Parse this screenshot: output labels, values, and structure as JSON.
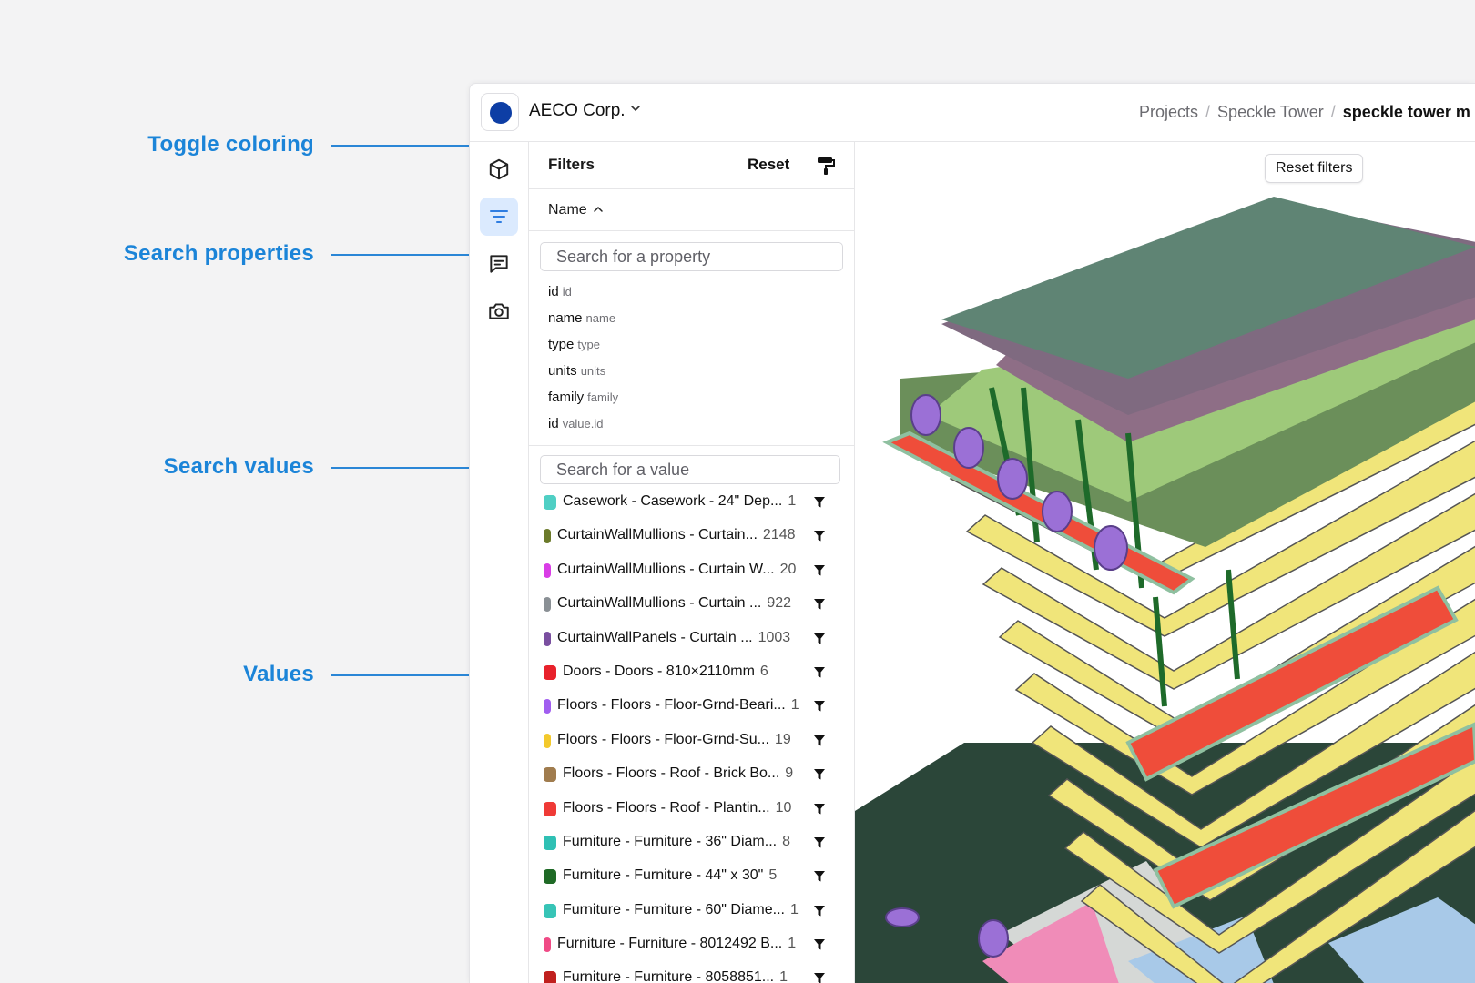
{
  "annotations": [
    {
      "label": "Toggle coloring"
    },
    {
      "label": "Search properties"
    },
    {
      "label": "Search values"
    },
    {
      "label": "Values"
    }
  ],
  "workspace": {
    "name": "AECO Corp.",
    "avatar_color": "#0d3ea5"
  },
  "breadcrumb": {
    "items": [
      "Projects",
      "Speckle Tower"
    ],
    "current": "speckle tower m"
  },
  "sidebar": {
    "icons": [
      "cube-icon",
      "filter-icon",
      "comment-icon",
      "camera-icon"
    ]
  },
  "filters": {
    "title": "Filters",
    "reset_label": "Reset",
    "sort_label": "Name",
    "property_search": {
      "placeholder": "Search for a property"
    },
    "properties": [
      {
        "key": "id",
        "path": "id"
      },
      {
        "key": "name",
        "path": "name"
      },
      {
        "key": "type",
        "path": "type"
      },
      {
        "key": "units",
        "path": "units"
      },
      {
        "key": "family",
        "path": "family"
      },
      {
        "key": "id",
        "path": "value.id"
      }
    ],
    "value_search": {
      "placeholder": "Search for a value"
    },
    "values": [
      {
        "label": "Casework - Casework - 24\" Dep...",
        "count": "1",
        "color": "#4fcfc4"
      },
      {
        "label": "CurtainWallMullions - Curtain...",
        "count": "2148",
        "color": "#6b7a2a"
      },
      {
        "label": "CurtainWallMullions - Curtain W...",
        "count": "20",
        "color": "#d93de6"
      },
      {
        "label": "CurtainWallMullions - Curtain ...",
        "count": "922",
        "color": "#8a9095"
      },
      {
        "label": "CurtainWallPanels - Curtain ...",
        "count": "1003",
        "color": "#7a4fa0"
      },
      {
        "label": "Doors - Doors - 810×2110mm",
        "count": "6",
        "color": "#e8212b"
      },
      {
        "label": "Floors - Floors - Floor-Grnd-Beari...",
        "count": "1",
        "color": "#a15ef0"
      },
      {
        "label": "Floors - Floors - Floor-Grnd-Su...",
        "count": "19",
        "color": "#f3c92c"
      },
      {
        "label": "Floors - Floors - Roof - Brick Bo...",
        "count": "9",
        "color": "#a07c4e"
      },
      {
        "label": "Floors - Floors - Roof - Plantin...",
        "count": "10",
        "color": "#ef3a36"
      },
      {
        "label": "Furniture - Furniture - 36\" Diam...",
        "count": "8",
        "color": "#2fc0b4"
      },
      {
        "label": "Furniture - Furniture - 44\" x 30\"",
        "count": "5",
        "color": "#1f6a26"
      },
      {
        "label": "Furniture - Furniture - 60\" Diame...",
        "count": "1",
        "color": "#37c4b6"
      },
      {
        "label": "Furniture - Furniture - 8012492 B...",
        "count": "1",
        "color": "#f04b86"
      },
      {
        "label": "Furniture - Furniture - 8058851...",
        "count": "1",
        "color": "#c0201e"
      }
    ]
  },
  "viewer": {
    "reset_filters_label": "Reset filters"
  }
}
